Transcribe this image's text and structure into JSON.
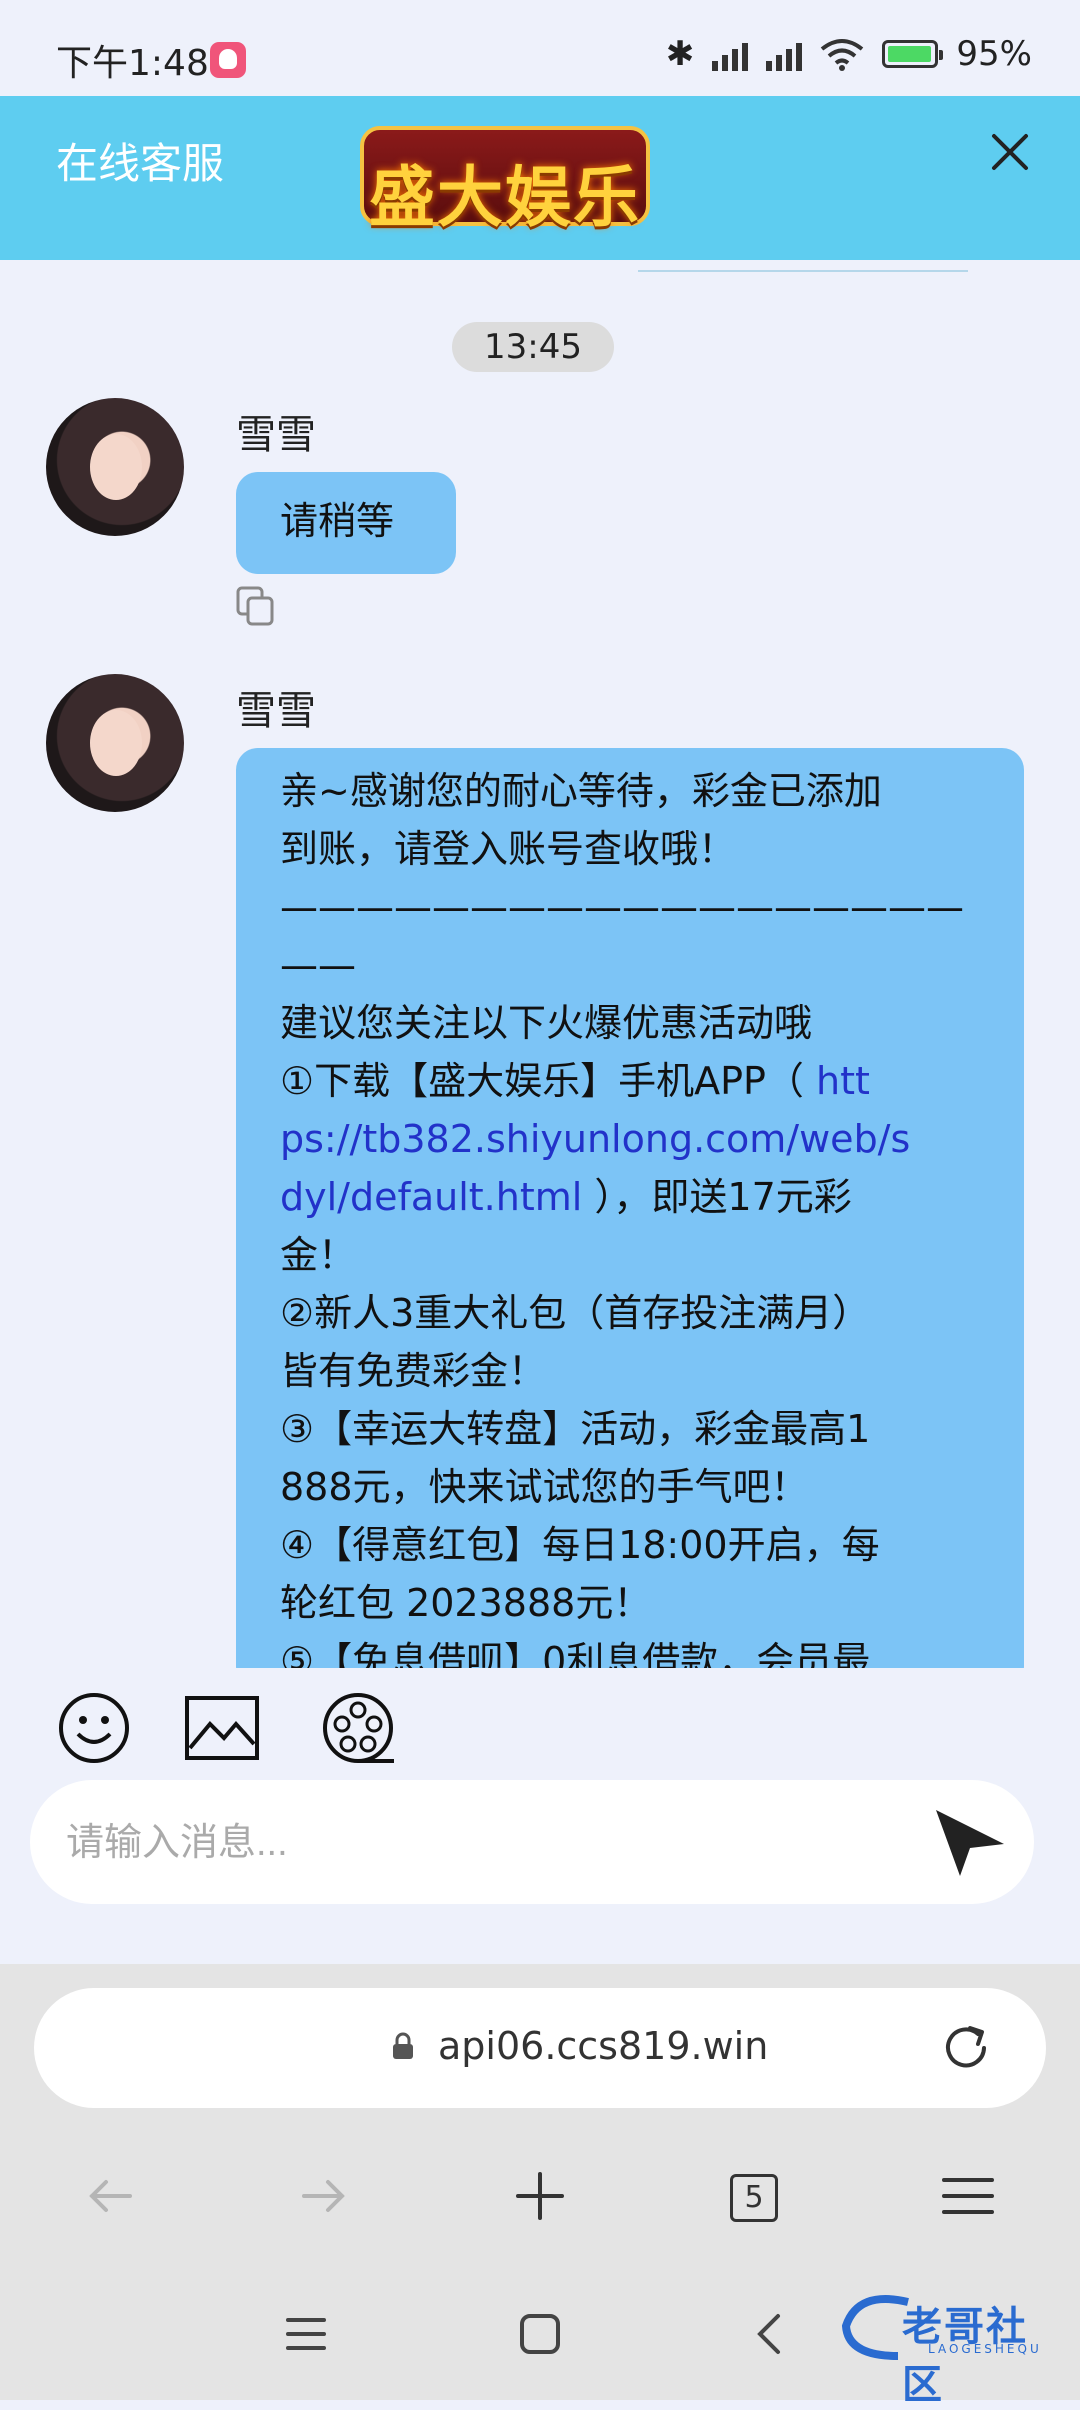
{
  "status_bar": {
    "time": "下午1:48",
    "battery": "95%"
  },
  "header": {
    "title": "在线客服",
    "brand_logo_text": "盛大娱乐"
  },
  "chat": {
    "timestamp": "13:45",
    "messages": [
      {
        "sender": "雪雪",
        "text": "请稍等"
      },
      {
        "sender": "雪雪",
        "lines": [
          "亲~感谢您的耐心等待，彩金已添加",
          "到账，请登入账号查收哦！",
          "——————————————————",
          "——",
          "建议您关注以下火爆优惠活动哦",
          "①下载【盛大娱乐】手机APP（ ",
          "ps://tb382.shiyunlong.com/web/s",
          "dyl/default.html",
          " ），即送17元彩",
          "金！",
          "②新人3重大礼包（首存投注满月）",
          "皆有免费彩金！",
          "③【幸运大转盘】活动，彩金最高1",
          "888元，快来试试您的手气吧！",
          "④【得意红包】每日18:00开启，每",
          "轮红包 2023888元！",
          "⑤【免息借呗】0利息借款，会员最"
        ],
        "link_prefix": "htt"
      }
    ]
  },
  "composer": {
    "placeholder": "请输入消息..."
  },
  "browser": {
    "url": "api06.ccs819.win",
    "tab_count": "5"
  },
  "watermark": {
    "text": "老哥社区",
    "sub": "LAOGESHEQU"
  }
}
